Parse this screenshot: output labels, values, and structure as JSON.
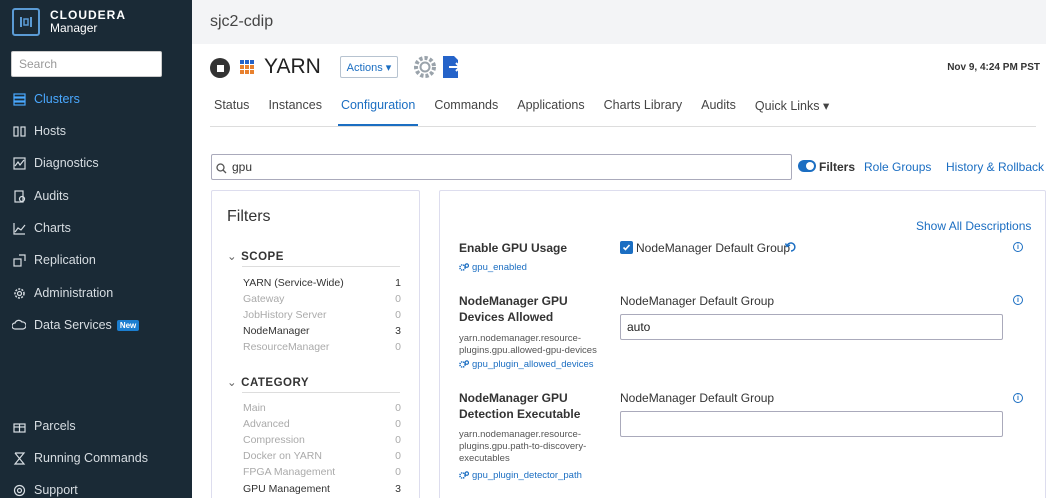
{
  "brand": {
    "line1": "CLOUDERA",
    "line2": "Manager"
  },
  "sidebar": {
    "search_placeholder": "Search",
    "items": [
      {
        "label": "Clusters",
        "icon": "clusters-icon",
        "active": true
      },
      {
        "label": "Hosts",
        "icon": "hosts-icon"
      },
      {
        "label": "Diagnostics",
        "icon": "diagnostics-icon"
      },
      {
        "label": "Audits",
        "icon": "audits-icon"
      },
      {
        "label": "Charts",
        "icon": "charts-icon"
      },
      {
        "label": "Replication",
        "icon": "replication-icon"
      },
      {
        "label": "Administration",
        "icon": "gear-icon"
      },
      {
        "label": "Data Services",
        "icon": "cloud-icon",
        "badge": "New"
      }
    ],
    "bottom_items": [
      {
        "label": "Parcels",
        "icon": "gift-icon"
      },
      {
        "label": "Running Commands",
        "icon": "hourglass-icon"
      },
      {
        "label": "Support",
        "icon": "support-icon"
      }
    ]
  },
  "header": {
    "cluster_name": "sjc2-cdip",
    "service_name": "YARN",
    "actions_label": "Actions ▾",
    "timestamp": "Nov 9, 4:24 PM PST"
  },
  "tabs": [
    {
      "label": "Status"
    },
    {
      "label": "Instances"
    },
    {
      "label": "Configuration",
      "active": true
    },
    {
      "label": "Commands"
    },
    {
      "label": "Applications"
    },
    {
      "label": "Charts Library"
    },
    {
      "label": "Audits"
    },
    {
      "label": "Quick Links ▾"
    }
  ],
  "toolbar": {
    "search_value": "gpu",
    "filters_label": "Filters",
    "role_groups": "Role Groups",
    "history": "History & Rollback"
  },
  "filters": {
    "title": "Filters",
    "scope_label": "SCOPE",
    "scope": [
      {
        "label": "YARN (Service-Wide)",
        "count": "1",
        "active": true
      },
      {
        "label": "Gateway",
        "count": "0"
      },
      {
        "label": "JobHistory Server",
        "count": "0"
      },
      {
        "label": "NodeManager",
        "count": "3",
        "active": true
      },
      {
        "label": "ResourceManager",
        "count": "0"
      }
    ],
    "category_label": "CATEGORY",
    "category": [
      {
        "label": "Main",
        "count": "0"
      },
      {
        "label": "Advanced",
        "count": "0"
      },
      {
        "label": "Compression",
        "count": "0"
      },
      {
        "label": "Docker on YARN",
        "count": "0"
      },
      {
        "label": "FPGA Management",
        "count": "0"
      },
      {
        "label": "GPU Management",
        "count": "3",
        "active": true
      }
    ]
  },
  "config": {
    "show_all": "Show All Descriptions",
    "rows": [
      {
        "title": "Enable GPU Usage",
        "property": "",
        "key": "gpu_enabled",
        "group": "NodeManager Default Group",
        "checked": true
      },
      {
        "title": "NodeManager GPU Devices Allowed",
        "property": "yarn.nodemanager.resource-plugins.gpu.allowed-gpu-devices",
        "key": "gpu_plugin_allowed_devices",
        "group": "NodeManager Default Group",
        "value": "auto"
      },
      {
        "title": "NodeManager GPU Detection Executable",
        "property": "yarn.nodemanager.resource-plugins.gpu.path-to-discovery-executables",
        "key": "gpu_plugin_detector_path",
        "group": "NodeManager Default Group",
        "value": ""
      }
    ]
  },
  "colors": {
    "accent": "#1b6ec2",
    "sidebar_bg": "#1a2a36",
    "active_nav": "#4aa8ff"
  }
}
